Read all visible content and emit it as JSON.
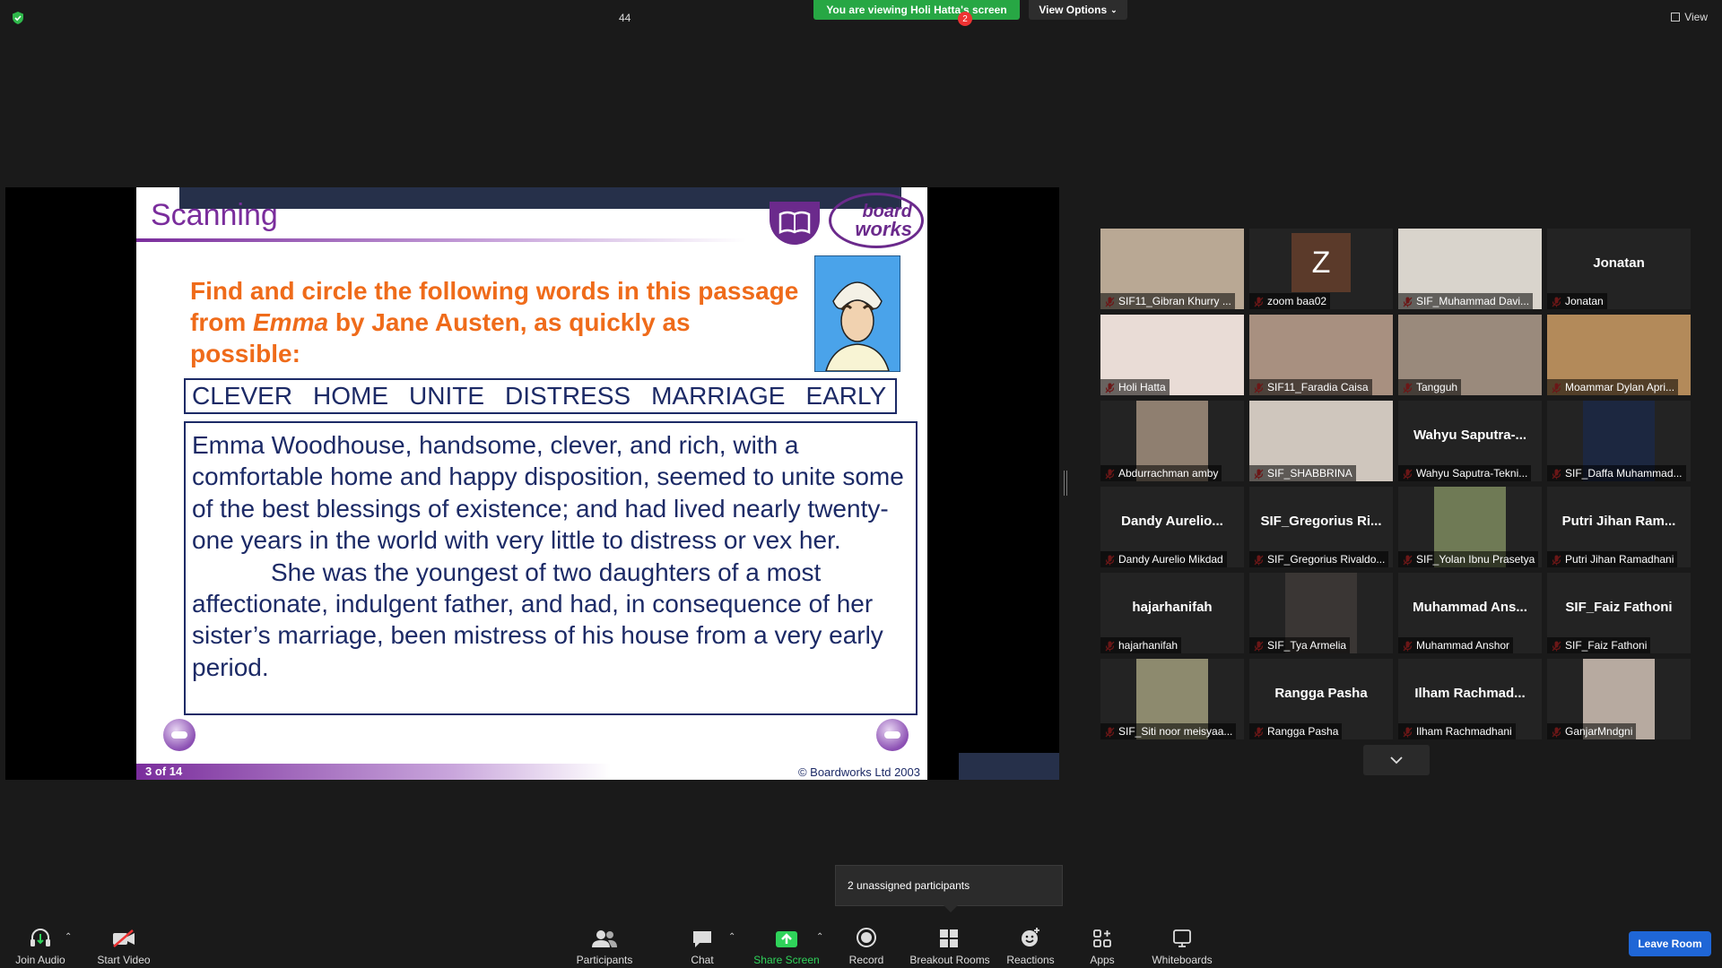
{
  "top": {
    "banner": "You are viewing Holi Hatta's screen",
    "view_options": "View Options",
    "view": "View"
  },
  "slide": {
    "title": "Scanning",
    "logo_top": "board",
    "logo_bottom": "works",
    "instruction_pre": "Find and circle the following words in this passage from ",
    "instruction_em": "Emma",
    "instruction_post": " by Jane Austen, as quickly as possible:",
    "words": [
      "CLEVER",
      "HOME",
      "UNITE",
      "DISTRESS",
      "MARRIAGE",
      "EARLY"
    ],
    "passage_1": "Emma Woodhouse, handsome, clever, and rich, with a comfortable home and happy disposition, seemed to unite some of the best blessings of existence; and had lived nearly twenty-one years in the world with very little to distress or vex her.",
    "passage_2": "She was the youngest of two daughters of a most affectionate, indulgent father, and had, in consequence of her sister’s marriage, been mistress of his house from a very early period.",
    "page": "3 of 14",
    "copyright": "© Boardworks Ltd 2003"
  },
  "gallery": [
    {
      "label": "SIF11_Gibran Khurry ...",
      "big": "",
      "video": true,
      "photo_color": "#b9a894"
    },
    {
      "label": "zoom baa02",
      "big": "",
      "initial": "Z",
      "video": false
    },
    {
      "label": "SIF_Muhammad Davi...",
      "big": "",
      "video": true,
      "photo_color": "#d9d4cc"
    },
    {
      "label": "Jonatan",
      "big": "Jonatan",
      "video": false
    },
    {
      "label": "Holi Hatta",
      "big": "",
      "video": true,
      "active": true,
      "photo_color": "#e9dcd6"
    },
    {
      "label": "SIF11_Faradia Caisa",
      "big": "",
      "video": true,
      "photo_color": "#a89080"
    },
    {
      "label": "Tangguh",
      "big": "",
      "video": true,
      "photo_color": "#9a8a7c"
    },
    {
      "label": "Moammar Dylan Apri...",
      "big": "",
      "video": true,
      "photo_color": "#b38a5a"
    },
    {
      "label": "Abdurrachman amby",
      "big": "",
      "video": true,
      "photo_color": "#8f7f70"
    },
    {
      "label": "SIF_SHABBRINA",
      "big": "",
      "video": true,
      "photo_color": "#cfc6bd"
    },
    {
      "label": "Wahyu Saputra-Tekni...",
      "big": "Wahyu  Saputra-...",
      "video": false
    },
    {
      "label": "SIF_Daffa Muhammad...",
      "big": "",
      "video": true,
      "photo_color": "#1c2740"
    },
    {
      "label": "Dandy Aurelio Mikdad",
      "big": "Dandy  Aurelio...",
      "video": false
    },
    {
      "label": "SIF_Gregorius Rivaldo...",
      "big": "SIF_Gregorius  Ri...",
      "video": false
    },
    {
      "label": "SIF_Yolan Ibnu Prasetya",
      "big": "",
      "video": true,
      "photo_color": "#6f7a55"
    },
    {
      "label": "Putri Jihan Ramadhani",
      "big": "Putri  Jihan  Ram...",
      "video": false
    },
    {
      "label": "hajarhanifah",
      "big": "hajarhanifah",
      "video": false
    },
    {
      "label": "SIF_Tya Armelia",
      "big": "",
      "video": true,
      "photo_color": "#3a3634"
    },
    {
      "label": "Muhammad Anshor",
      "big": "Muhammad  Ans...",
      "video": false
    },
    {
      "label": "SIF_Faiz Fathoni",
      "big": "SIF_Faiz  Fathoni",
      "video": false
    },
    {
      "label": "SIF_Siti noor meisyaa...",
      "big": "",
      "video": true,
      "photo_color": "#8d8a6e"
    },
    {
      "label": "Rangga Pasha",
      "big": "Rangga  Pasha",
      "video": false
    },
    {
      "label": "Ilham Rachmadhani",
      "big": "Ilham  Rachmad...",
      "video": false
    },
    {
      "label": "GanjarMndgni",
      "big": "",
      "video": true,
      "photo_color": "#b7aaa0"
    }
  ],
  "tooltip": "2 unassigned participants",
  "toolbar": {
    "join_audio": "Join Audio",
    "start_video": "Start Video",
    "participants": "Participants",
    "participants_count": "44",
    "chat": "Chat",
    "share_screen": "Share Screen",
    "record": "Record",
    "breakout_rooms": "Breakout Rooms",
    "breakout_badge": "2",
    "reactions": "Reactions",
    "apps": "Apps",
    "whiteboards": "Whiteboards",
    "leave_room": "Leave Room"
  },
  "colors": {
    "banner_green": "#27a744",
    "share_green": "#2fd35a",
    "leave_blue": "#1f66d6",
    "active_speaker": "#f3e04b",
    "slide_purple": "#7a2d9c",
    "slide_orange": "#ef6b1a",
    "slide_navy": "#1c2a66"
  }
}
